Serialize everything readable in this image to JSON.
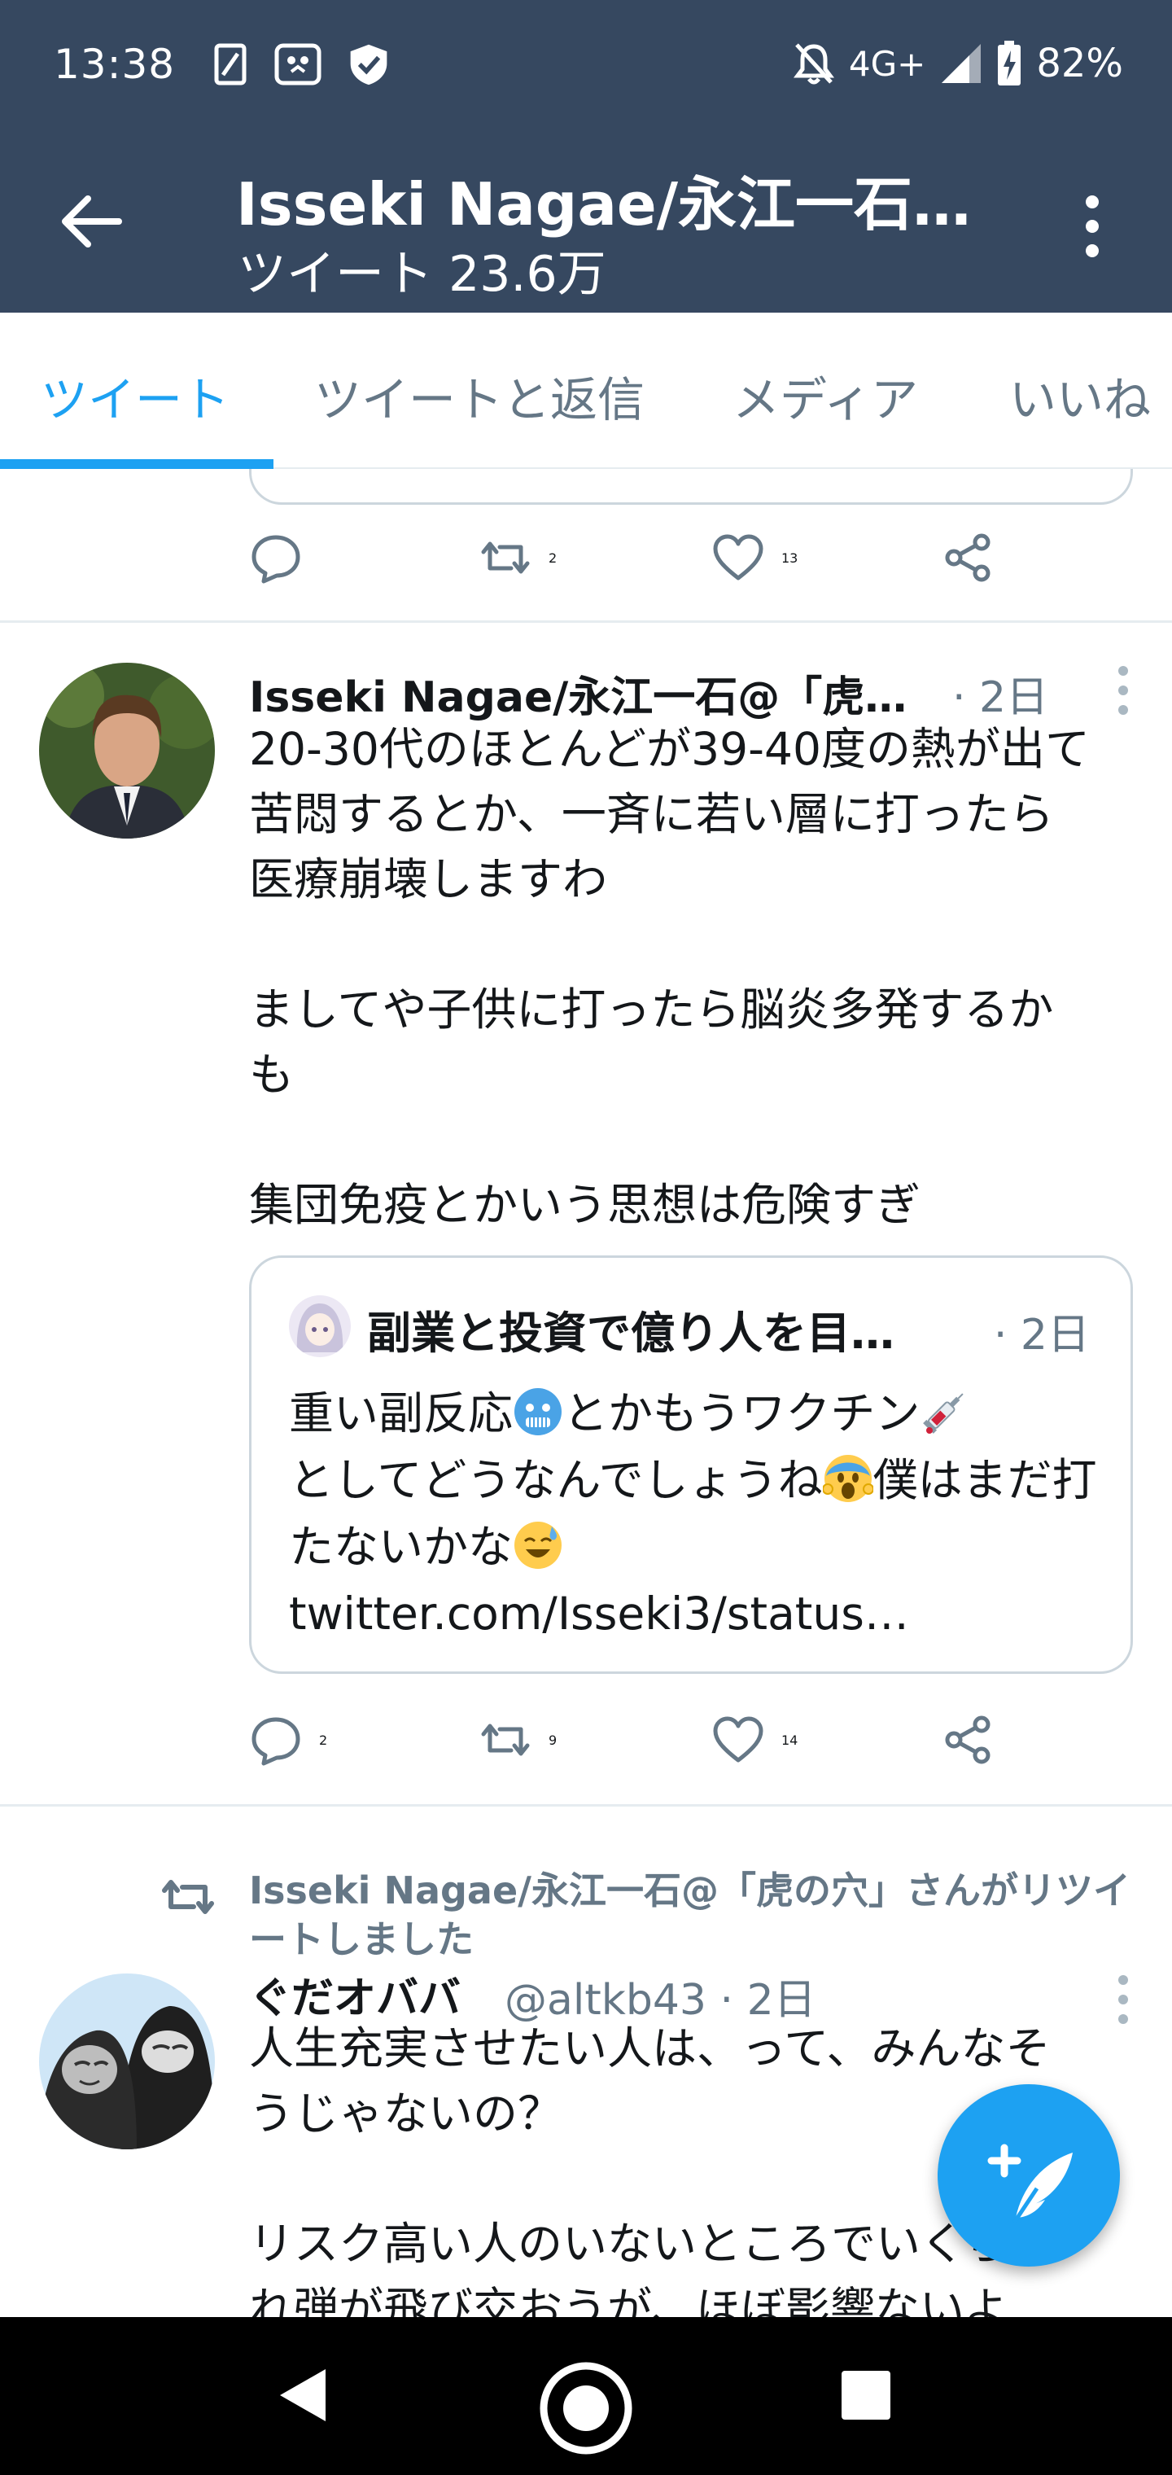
{
  "status_bar": {
    "time": "13:38",
    "network": "4G+",
    "battery": "82%"
  },
  "header": {
    "title": "Isseki Nagae/永江一石…",
    "subtitle": "ツイート 23.6万"
  },
  "tabs": [
    {
      "label": "ツイート",
      "active": true
    },
    {
      "label": "ツイートと返信",
      "active": false
    },
    {
      "label": "メディア",
      "active": false
    },
    {
      "label": "いいね",
      "active": false
    }
  ],
  "prev_tweet_actions": {
    "reply_count": "",
    "retweet_count": "2",
    "like_count": "13"
  },
  "tweet1": {
    "name": "Isseki Nagae/永江一石@「虎…",
    "date": "· 2日",
    "body": "20-30代のほとんどが39-40度の熱が出て\n苦悶するとか、一斉に若い層に打ったら\n医療崩壊しますわ\n\nましてや子供に打ったら脳炎多発するか\nも\n\n集団免疫とかいう思想は危険すぎ",
    "quote": {
      "name": "副業と投資で億り人を目…",
      "date": "· 2日",
      "text_1": "重い副反応",
      "text_2": "とかもうワクチン",
      "text_3": "としてどうなんでしょうね",
      "text_4": "僕はまだ打たないかな",
      "text_5": " twitter.com/Isseki3/status…"
    },
    "actions": {
      "reply_count": "2",
      "retweet_count": "9",
      "like_count": "14"
    }
  },
  "retweet_notice": "Isseki Nagae/永江一石@「虎の穴」さんがリツイートしました",
  "tweet2": {
    "name": "ぐだオババ",
    "handle": "@altkb43 · 2日",
    "body": "人生充実させたい人は、って、みんなそ\nうじゃないの？\n\nリスク高い人のいないところでいくら流\nれ弾が飛び交おうが、ほぼ影響ないよ"
  },
  "colors": {
    "header_bg": "#364860",
    "accent": "#1da1f2",
    "muted": "#657786"
  }
}
